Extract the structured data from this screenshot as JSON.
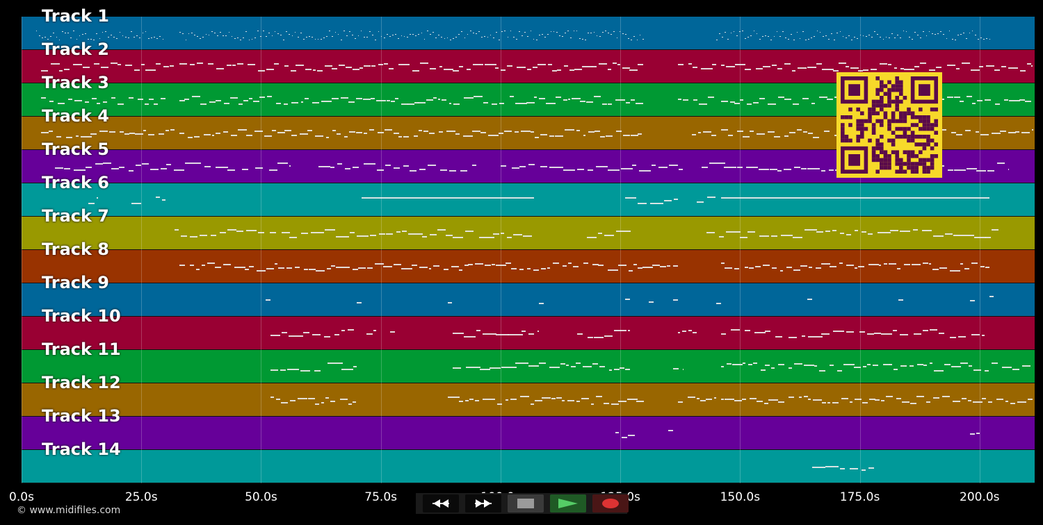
{
  "tracks": [
    {
      "label": "Track 1",
      "color": "#006699",
      "density": "dots"
    },
    {
      "label": "Track 2",
      "color": "#990033"
    },
    {
      "label": "Track 3",
      "color": "#009933"
    },
    {
      "label": "Track 4",
      "color": "#996600"
    },
    {
      "label": "Track 5",
      "color": "#660099"
    },
    {
      "label": "Track 6",
      "color": "#009999"
    },
    {
      "label": "Track 7",
      "color": "#999900"
    },
    {
      "label": "Track 8",
      "color": "#993300"
    },
    {
      "label": "Track 9",
      "color": "#006699"
    },
    {
      "label": "Track 10",
      "color": "#990033"
    },
    {
      "label": "Track 11",
      "color": "#009933"
    },
    {
      "label": "Track 12",
      "color": "#996600"
    },
    {
      "label": "Track 13",
      "color": "#660099"
    },
    {
      "label": "Track 14",
      "color": "#009999"
    }
  ],
  "time_axis": {
    "unit": "s",
    "max_seconds": 211.5,
    "ticks": [
      "0.0s",
      "25.0s",
      "50.0s",
      "75.0s",
      "100.0s",
      "125.0s",
      "150.0s",
      "175.0s",
      "200.0s"
    ]
  },
  "copyright": "© www.midifiles.com",
  "transport": {
    "rewind_icon": "rewind-icon",
    "fast_forward_icon": "fast-forward-icon",
    "stop_icon": "stop-icon",
    "play_icon": "play-icon",
    "record_icon": "record-icon",
    "play_color": "#55cc66",
    "record_color": "#dd3333"
  },
  "qr_code": {
    "fg": "#5a0a4a",
    "bg": "#f7d92a"
  },
  "note_segments": [
    [
      [
        3,
        30,
        "d"
      ],
      [
        33,
        130,
        "d"
      ],
      [
        145,
        202,
        "d"
      ]
    ],
    [
      [
        4,
        32,
        "s"
      ],
      [
        33,
        130,
        "s"
      ],
      [
        137,
        145,
        "s"
      ],
      [
        146,
        211,
        "s"
      ]
    ],
    [
      [
        4,
        30,
        "s"
      ],
      [
        33,
        130,
        "s"
      ],
      [
        137,
        145,
        "s"
      ],
      [
        146,
        211,
        "s"
      ]
    ],
    [
      [
        4,
        32,
        "s"
      ],
      [
        33,
        130,
        "s"
      ],
      [
        140,
        145,
        "s"
      ],
      [
        146,
        211,
        "s"
      ]
    ],
    [
      [
        7,
        56,
        "p"
      ],
      [
        62,
        95,
        "p"
      ],
      [
        100,
        138,
        "p"
      ],
      [
        142,
        206,
        "p"
      ]
    ],
    [
      [
        14,
        16,
        "p"
      ],
      [
        23,
        25,
        "p"
      ],
      [
        28,
        30,
        "p"
      ],
      [
        71,
        107,
        "l"
      ],
      [
        126,
        137,
        "p"
      ],
      [
        141,
        145,
        "p"
      ],
      [
        146,
        202,
        "l"
      ]
    ],
    [
      [
        32,
        107,
        "p"
      ],
      [
        118,
        127,
        "p"
      ],
      [
        143,
        204,
        "p"
      ]
    ],
    [
      [
        33,
        137,
        "s"
      ],
      [
        146,
        202,
        "s"
      ]
    ],
    [
      [
        51,
        52,
        "p"
      ],
      [
        70,
        71,
        "p"
      ],
      [
        89,
        90,
        "p"
      ],
      [
        108,
        109,
        "p"
      ],
      [
        126,
        127,
        "p"
      ],
      [
        131,
        132,
        "p"
      ],
      [
        136,
        137,
        "p"
      ],
      [
        145,
        146,
        "p"
      ],
      [
        164,
        165,
        "p"
      ],
      [
        183,
        184,
        "p"
      ],
      [
        198,
        199,
        "p"
      ],
      [
        202,
        203,
        "p"
      ]
    ],
    [
      [
        52,
        70,
        "p"
      ],
      [
        72,
        74,
        "p"
      ],
      [
        77,
        78,
        "p"
      ],
      [
        90,
        108,
        "p"
      ],
      [
        116,
        127,
        "p"
      ],
      [
        137,
        141,
        "s"
      ],
      [
        146,
        201,
        "p"
      ]
    ],
    [
      [
        52,
        70,
        "p"
      ],
      [
        90,
        108,
        "p"
      ],
      [
        108,
        127,
        "s"
      ],
      [
        136,
        138,
        "s"
      ],
      [
        146,
        211,
        "s"
      ]
    ],
    [
      [
        52,
        70,
        "s"
      ],
      [
        89,
        130,
        "s"
      ],
      [
        137,
        145,
        "s"
      ],
      [
        146,
        211,
        "s"
      ]
    ],
    [
      [
        124,
        128,
        "p"
      ],
      [
        135,
        136,
        "p"
      ],
      [
        198,
        200,
        "p"
      ]
    ],
    [
      [
        165,
        178,
        "p"
      ]
    ]
  ]
}
